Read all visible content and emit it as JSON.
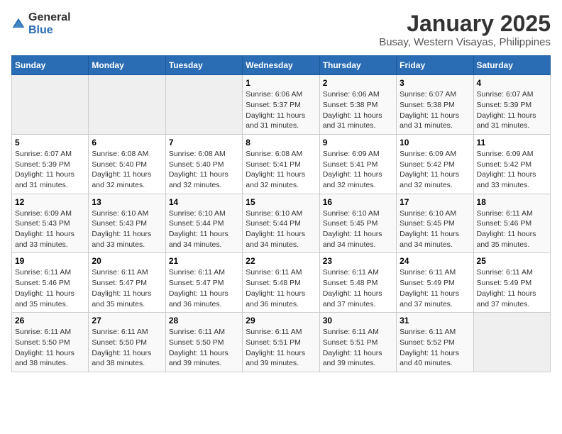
{
  "logo": {
    "general": "General",
    "blue": "Blue"
  },
  "title": "January 2025",
  "subtitle": "Busay, Western Visayas, Philippines",
  "headers": [
    "Sunday",
    "Monday",
    "Tuesday",
    "Wednesday",
    "Thursday",
    "Friday",
    "Saturday"
  ],
  "weeks": [
    [
      {
        "day": "",
        "sunrise": "",
        "sunset": "",
        "daylight": "",
        "empty": true
      },
      {
        "day": "",
        "sunrise": "",
        "sunset": "",
        "daylight": "",
        "empty": true
      },
      {
        "day": "",
        "sunrise": "",
        "sunset": "",
        "daylight": "",
        "empty": true
      },
      {
        "day": "1",
        "sunrise": "Sunrise: 6:06 AM",
        "sunset": "Sunset: 5:37 PM",
        "daylight": "Daylight: 11 hours and 31 minutes."
      },
      {
        "day": "2",
        "sunrise": "Sunrise: 6:06 AM",
        "sunset": "Sunset: 5:38 PM",
        "daylight": "Daylight: 11 hours and 31 minutes."
      },
      {
        "day": "3",
        "sunrise": "Sunrise: 6:07 AM",
        "sunset": "Sunset: 5:38 PM",
        "daylight": "Daylight: 11 hours and 31 minutes."
      },
      {
        "day": "4",
        "sunrise": "Sunrise: 6:07 AM",
        "sunset": "Sunset: 5:39 PM",
        "daylight": "Daylight: 11 hours and 31 minutes."
      }
    ],
    [
      {
        "day": "5",
        "sunrise": "Sunrise: 6:07 AM",
        "sunset": "Sunset: 5:39 PM",
        "daylight": "Daylight: 11 hours and 31 minutes."
      },
      {
        "day": "6",
        "sunrise": "Sunrise: 6:08 AM",
        "sunset": "Sunset: 5:40 PM",
        "daylight": "Daylight: 11 hours and 32 minutes."
      },
      {
        "day": "7",
        "sunrise": "Sunrise: 6:08 AM",
        "sunset": "Sunset: 5:40 PM",
        "daylight": "Daylight: 11 hours and 32 minutes."
      },
      {
        "day": "8",
        "sunrise": "Sunrise: 6:08 AM",
        "sunset": "Sunset: 5:41 PM",
        "daylight": "Daylight: 11 hours and 32 minutes."
      },
      {
        "day": "9",
        "sunrise": "Sunrise: 6:09 AM",
        "sunset": "Sunset: 5:41 PM",
        "daylight": "Daylight: 11 hours and 32 minutes."
      },
      {
        "day": "10",
        "sunrise": "Sunrise: 6:09 AM",
        "sunset": "Sunset: 5:42 PM",
        "daylight": "Daylight: 11 hours and 32 minutes."
      },
      {
        "day": "11",
        "sunrise": "Sunrise: 6:09 AM",
        "sunset": "Sunset: 5:42 PM",
        "daylight": "Daylight: 11 hours and 33 minutes."
      }
    ],
    [
      {
        "day": "12",
        "sunrise": "Sunrise: 6:09 AM",
        "sunset": "Sunset: 5:43 PM",
        "daylight": "Daylight: 11 hours and 33 minutes."
      },
      {
        "day": "13",
        "sunrise": "Sunrise: 6:10 AM",
        "sunset": "Sunset: 5:43 PM",
        "daylight": "Daylight: 11 hours and 33 minutes."
      },
      {
        "day": "14",
        "sunrise": "Sunrise: 6:10 AM",
        "sunset": "Sunset: 5:44 PM",
        "daylight": "Daylight: 11 hours and 34 minutes."
      },
      {
        "day": "15",
        "sunrise": "Sunrise: 6:10 AM",
        "sunset": "Sunset: 5:44 PM",
        "daylight": "Daylight: 11 hours and 34 minutes."
      },
      {
        "day": "16",
        "sunrise": "Sunrise: 6:10 AM",
        "sunset": "Sunset: 5:45 PM",
        "daylight": "Daylight: 11 hours and 34 minutes."
      },
      {
        "day": "17",
        "sunrise": "Sunrise: 6:10 AM",
        "sunset": "Sunset: 5:45 PM",
        "daylight": "Daylight: 11 hours and 34 minutes."
      },
      {
        "day": "18",
        "sunrise": "Sunrise: 6:11 AM",
        "sunset": "Sunset: 5:46 PM",
        "daylight": "Daylight: 11 hours and 35 minutes."
      }
    ],
    [
      {
        "day": "19",
        "sunrise": "Sunrise: 6:11 AM",
        "sunset": "Sunset: 5:46 PM",
        "daylight": "Daylight: 11 hours and 35 minutes."
      },
      {
        "day": "20",
        "sunrise": "Sunrise: 6:11 AM",
        "sunset": "Sunset: 5:47 PM",
        "daylight": "Daylight: 11 hours and 35 minutes."
      },
      {
        "day": "21",
        "sunrise": "Sunrise: 6:11 AM",
        "sunset": "Sunset: 5:47 PM",
        "daylight": "Daylight: 11 hours and 36 minutes."
      },
      {
        "day": "22",
        "sunrise": "Sunrise: 6:11 AM",
        "sunset": "Sunset: 5:48 PM",
        "daylight": "Daylight: 11 hours and 36 minutes."
      },
      {
        "day": "23",
        "sunrise": "Sunrise: 6:11 AM",
        "sunset": "Sunset: 5:48 PM",
        "daylight": "Daylight: 11 hours and 37 minutes."
      },
      {
        "day": "24",
        "sunrise": "Sunrise: 6:11 AM",
        "sunset": "Sunset: 5:49 PM",
        "daylight": "Daylight: 11 hours and 37 minutes."
      },
      {
        "day": "25",
        "sunrise": "Sunrise: 6:11 AM",
        "sunset": "Sunset: 5:49 PM",
        "daylight": "Daylight: 11 hours and 37 minutes."
      }
    ],
    [
      {
        "day": "26",
        "sunrise": "Sunrise: 6:11 AM",
        "sunset": "Sunset: 5:50 PM",
        "daylight": "Daylight: 11 hours and 38 minutes."
      },
      {
        "day": "27",
        "sunrise": "Sunrise: 6:11 AM",
        "sunset": "Sunset: 5:50 PM",
        "daylight": "Daylight: 11 hours and 38 minutes."
      },
      {
        "day": "28",
        "sunrise": "Sunrise: 6:11 AM",
        "sunset": "Sunset: 5:50 PM",
        "daylight": "Daylight: 11 hours and 39 minutes."
      },
      {
        "day": "29",
        "sunrise": "Sunrise: 6:11 AM",
        "sunset": "Sunset: 5:51 PM",
        "daylight": "Daylight: 11 hours and 39 minutes."
      },
      {
        "day": "30",
        "sunrise": "Sunrise: 6:11 AM",
        "sunset": "Sunset: 5:51 PM",
        "daylight": "Daylight: 11 hours and 39 minutes."
      },
      {
        "day": "31",
        "sunrise": "Sunrise: 6:11 AM",
        "sunset": "Sunset: 5:52 PM",
        "daylight": "Daylight: 11 hours and 40 minutes."
      },
      {
        "day": "",
        "sunrise": "",
        "sunset": "",
        "daylight": "",
        "empty": true
      }
    ]
  ]
}
